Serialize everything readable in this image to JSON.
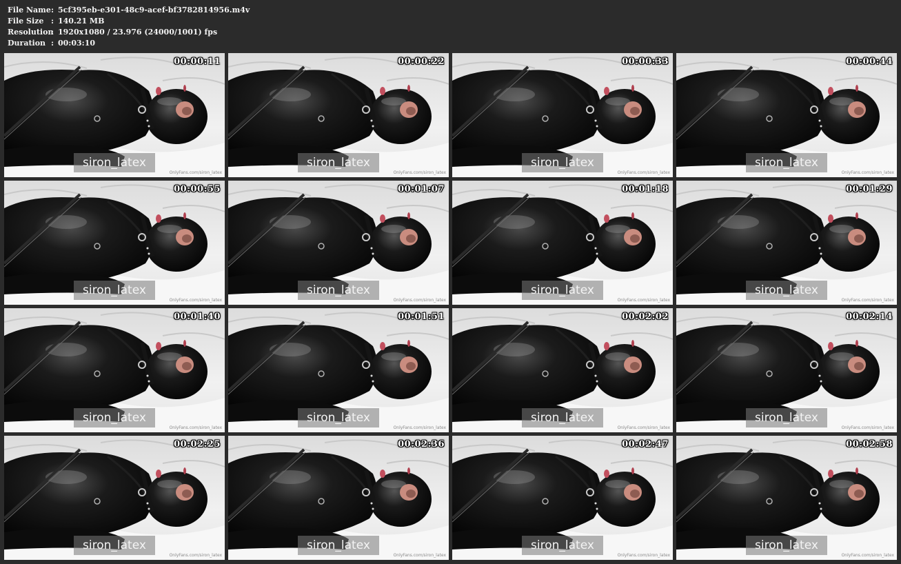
{
  "info": {
    "rows": [
      {
        "label": "File Name",
        "sep": ":",
        "value": "5cf395eb-e301-48c9-acef-bf3782814956.m4v"
      },
      {
        "label": "File Size",
        "sep": ":",
        "value": "140.21 MB"
      },
      {
        "label": "Resolution",
        "sep": ":",
        "value": "1920x1080 / 23.976 (24000/1001) fps"
      },
      {
        "label": "Duration",
        "sep": ":",
        "value": "00:03:10"
      }
    ]
  },
  "thumbnails": [
    {
      "time": "00:00:11",
      "watermark": "siron_latex",
      "source": "OnlyFans.com/siron_latex"
    },
    {
      "time": "00:00:22",
      "watermark": "siron_latex",
      "source": "OnlyFans.com/siron_latex"
    },
    {
      "time": "00:00:33",
      "watermark": "siron_latex",
      "source": "OnlyFans.com/siron_latex"
    },
    {
      "time": "00:00:44",
      "watermark": "siron_latex",
      "source": "OnlyFans.com/siron_latex"
    },
    {
      "time": "00:00:55",
      "watermark": "siron_latex",
      "source": "OnlyFans.com/siron_latex"
    },
    {
      "time": "00:01:07",
      "watermark": "siron_latex",
      "source": "OnlyFans.com/siron_latex"
    },
    {
      "time": "00:01:18",
      "watermark": "siron_latex",
      "source": "OnlyFans.com/siron_latex"
    },
    {
      "time": "00:01:29",
      "watermark": "siron_latex",
      "source": "OnlyFans.com/siron_latex"
    },
    {
      "time": "00:01:40",
      "watermark": "siron_latex",
      "source": "OnlyFans.com/siron_latex"
    },
    {
      "time": "00:01:51",
      "watermark": "siron_latex",
      "source": "OnlyFans.com/siron_latex"
    },
    {
      "time": "00:02:02",
      "watermark": "siron_latex",
      "source": "OnlyFans.com/siron_latex"
    },
    {
      "time": "00:02:14",
      "watermark": "siron_latex",
      "source": "OnlyFans.com/siron_latex"
    },
    {
      "time": "00:02:25",
      "watermark": "siron_latex",
      "source": "OnlyFans.com/siron_latex"
    },
    {
      "time": "00:02:36",
      "watermark": "siron_latex",
      "source": "OnlyFans.com/siron_latex"
    },
    {
      "time": "00:02:47",
      "watermark": "siron_latex",
      "source": "OnlyFans.com/siron_latex"
    },
    {
      "time": "00:02:58",
      "watermark": "siron_latex",
      "source": "OnlyFans.com/siron_latex"
    }
  ]
}
